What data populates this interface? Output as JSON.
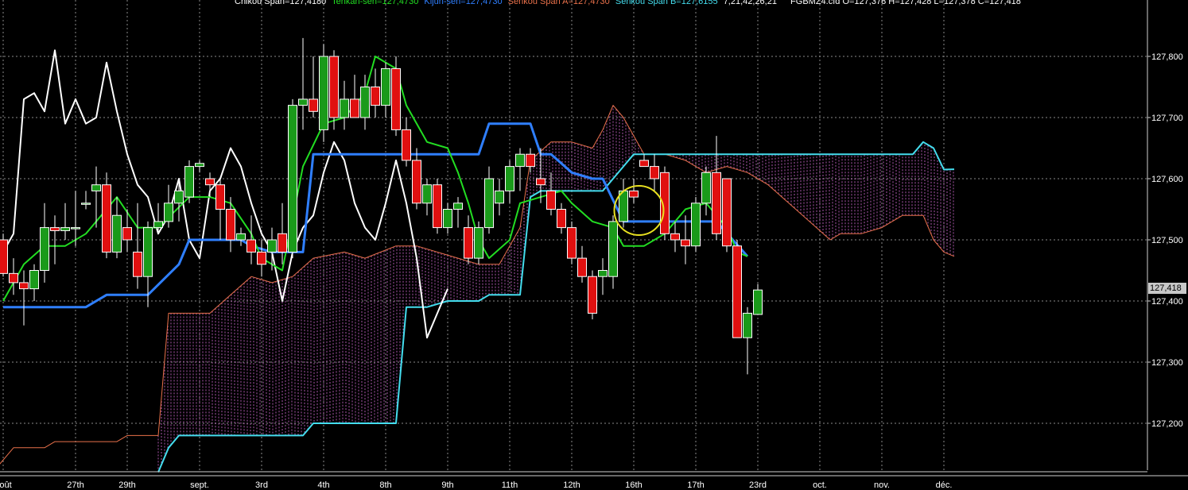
{
  "header": {
    "chikou": "Chikou Span=127,4180",
    "tenkan": "Tenkan-sen=127,4730",
    "kijun": "Kijun-sen=127,4730",
    "senkou_a": "Senkou Span A=127,4730",
    "senkou_b": "Senkou Span B=127,6155",
    "params": "7,21,42,26,21",
    "ohlc": "FGBMZ4.cfd O=127,378 H=127,428 L=127,378 C=127,418"
  },
  "colors": {
    "background": "#000000",
    "bull": "#1a9a1a",
    "bear": "#e01010",
    "tenkan": "#22dd22",
    "kijun": "#2f7fff",
    "senkou_a": "#e8704a",
    "senkou_b": "#44ddee",
    "chikou": "#ffffff",
    "cloud_hatch": "#cc66cc",
    "grid": "#8a8a8a",
    "highlight_circle": "#e8e020"
  },
  "last_price_label": "127,418",
  "chart_data": {
    "type": "candlestick",
    "symbol": "FGBMZ4.cfd",
    "ylim": [
      127.14,
      127.88
    ],
    "y_ticks": [
      {
        "value": 127.8,
        "label": "127,800"
      },
      {
        "value": 127.7,
        "label": "127,700"
      },
      {
        "value": 127.6,
        "label": "127,600"
      },
      {
        "value": 127.5,
        "label": "127,500"
      },
      {
        "value": 127.4,
        "label": "127,400"
      },
      {
        "value": 127.3,
        "label": "127,300"
      },
      {
        "value": 127.2,
        "label": "127,200"
      }
    ],
    "x_labels": [
      {
        "bar": 0,
        "label": "août"
      },
      {
        "bar": 7,
        "label": "27th"
      },
      {
        "bar": 12,
        "label": "29th"
      },
      {
        "bar": 19,
        "label": "sept."
      },
      {
        "bar": 25,
        "label": "3rd"
      },
      {
        "bar": 31,
        "label": "4th"
      },
      {
        "bar": 37,
        "label": "8th"
      },
      {
        "bar": 43,
        "label": "9th"
      },
      {
        "bar": 49,
        "label": "11th"
      },
      {
        "bar": 55,
        "label": "12th"
      },
      {
        "bar": 61,
        "label": "16th"
      },
      {
        "bar": 67,
        "label": "17th"
      },
      {
        "bar": 73,
        "label": "23rd"
      },
      {
        "bar": 79,
        "label": "oct."
      },
      {
        "bar": 85,
        "label": "nov."
      },
      {
        "bar": 91,
        "label": "déc."
      }
    ],
    "candles": [
      {
        "o": 127.5,
        "h": 127.51,
        "l": 127.44,
        "c": 127.445
      },
      {
        "o": 127.445,
        "h": 127.47,
        "l": 127.41,
        "c": 127.43
      },
      {
        "o": 127.43,
        "h": 127.45,
        "l": 127.36,
        "c": 127.42
      },
      {
        "o": 127.42,
        "h": 127.46,
        "l": 127.4,
        "c": 127.45
      },
      {
        "o": 127.45,
        "h": 127.56,
        "l": 127.43,
        "c": 127.52
      },
      {
        "o": 127.52,
        "h": 127.54,
        "l": 127.46,
        "c": 127.515
      },
      {
        "o": 127.515,
        "h": 127.56,
        "l": 127.5,
        "c": 127.52
      },
      {
        "o": 127.52,
        "h": 127.58,
        "l": 127.49,
        "c": 127.52
      },
      {
        "o": 127.56,
        "h": 127.58,
        "l": 127.55,
        "c": 127.56
      },
      {
        "o": 127.58,
        "h": 127.62,
        "l": 127.52,
        "c": 127.59
      },
      {
        "o": 127.59,
        "h": 127.61,
        "l": 127.47,
        "c": 127.48
      },
      {
        "o": 127.48,
        "h": 127.57,
        "l": 127.47,
        "c": 127.54
      },
      {
        "o": 127.52,
        "h": 127.55,
        "l": 127.48,
        "c": 127.5
      },
      {
        "o": 127.48,
        "h": 127.56,
        "l": 127.42,
        "c": 127.44
      },
      {
        "o": 127.44,
        "h": 127.53,
        "l": 127.39,
        "c": 127.52
      },
      {
        "o": 127.52,
        "h": 127.56,
        "l": 127.51,
        "c": 127.53
      },
      {
        "o": 127.53,
        "h": 127.59,
        "l": 127.52,
        "c": 127.56
      },
      {
        "o": 127.56,
        "h": 127.6,
        "l": 127.53,
        "c": 127.58
      },
      {
        "o": 127.57,
        "h": 127.63,
        "l": 127.56,
        "c": 127.62
      },
      {
        "o": 127.62,
        "h": 127.63,
        "l": 127.61,
        "c": 127.625
      },
      {
        "o": 127.6,
        "h": 127.61,
        "l": 127.57,
        "c": 127.59
      },
      {
        "o": 127.59,
        "h": 127.6,
        "l": 127.5,
        "c": 127.55
      },
      {
        "o": 127.55,
        "h": 127.57,
        "l": 127.48,
        "c": 127.5
      },
      {
        "o": 127.5,
        "h": 127.52,
        "l": 127.49,
        "c": 127.51
      },
      {
        "o": 127.5,
        "h": 127.54,
        "l": 127.46,
        "c": 127.48
      },
      {
        "o": 127.48,
        "h": 127.5,
        "l": 127.44,
        "c": 127.46
      },
      {
        "o": 127.48,
        "h": 127.52,
        "l": 127.45,
        "c": 127.5
      },
      {
        "o": 127.51,
        "h": 127.56,
        "l": 127.46,
        "c": 127.48
      },
      {
        "o": 127.48,
        "h": 127.73,
        "l": 127.47,
        "c": 127.72
      },
      {
        "o": 127.72,
        "h": 127.83,
        "l": 127.68,
        "c": 127.73
      },
      {
        "o": 127.73,
        "h": 127.8,
        "l": 127.7,
        "c": 127.71
      },
      {
        "o": 127.68,
        "h": 127.82,
        "l": 127.66,
        "c": 127.8
      },
      {
        "o": 127.8,
        "h": 127.81,
        "l": 127.68,
        "c": 127.7
      },
      {
        "o": 127.7,
        "h": 127.76,
        "l": 127.68,
        "c": 127.73
      },
      {
        "o": 127.73,
        "h": 127.77,
        "l": 127.7,
        "c": 127.7
      },
      {
        "o": 127.7,
        "h": 127.77,
        "l": 127.68,
        "c": 127.75
      },
      {
        "o": 127.75,
        "h": 127.78,
        "l": 127.7,
        "c": 127.72
      },
      {
        "o": 127.72,
        "h": 127.79,
        "l": 127.7,
        "c": 127.78
      },
      {
        "o": 127.78,
        "h": 127.8,
        "l": 127.67,
        "c": 127.68
      },
      {
        "o": 127.68,
        "h": 127.7,
        "l": 127.62,
        "c": 127.63
      },
      {
        "o": 127.63,
        "h": 127.65,
        "l": 127.55,
        "c": 127.56
      },
      {
        "o": 127.56,
        "h": 127.6,
        "l": 127.54,
        "c": 127.59
      },
      {
        "o": 127.59,
        "h": 127.6,
        "l": 127.51,
        "c": 127.52
      },
      {
        "o": 127.52,
        "h": 127.56,
        "l": 127.51,
        "c": 127.55
      },
      {
        "o": 127.55,
        "h": 127.57,
        "l": 127.52,
        "c": 127.56
      },
      {
        "o": 127.52,
        "h": 127.54,
        "l": 127.46,
        "c": 127.47
      },
      {
        "o": 127.47,
        "h": 127.53,
        "l": 127.46,
        "c": 127.52
      },
      {
        "o": 127.52,
        "h": 127.62,
        "l": 127.51,
        "c": 127.6
      },
      {
        "o": 127.56,
        "h": 127.6,
        "l": 127.54,
        "c": 127.58
      },
      {
        "o": 127.58,
        "h": 127.63,
        "l": 127.56,
        "c": 127.62
      },
      {
        "o": 127.62,
        "h": 127.65,
        "l": 127.58,
        "c": 127.64
      },
      {
        "o": 127.64,
        "h": 127.65,
        "l": 127.61,
        "c": 127.62
      },
      {
        "o": 127.6,
        "h": 127.65,
        "l": 127.56,
        "c": 127.59
      },
      {
        "o": 127.58,
        "h": 127.61,
        "l": 127.54,
        "c": 127.55
      },
      {
        "o": 127.55,
        "h": 127.56,
        "l": 127.51,
        "c": 127.52
      },
      {
        "o": 127.52,
        "h": 127.53,
        "l": 127.46,
        "c": 127.47
      },
      {
        "o": 127.47,
        "h": 127.49,
        "l": 127.43,
        "c": 127.44
      },
      {
        "o": 127.44,
        "h": 127.45,
        "l": 127.37,
        "c": 127.38
      },
      {
        "o": 127.44,
        "h": 127.47,
        "l": 127.41,
        "c": 127.45
      },
      {
        "o": 127.44,
        "h": 127.54,
        "l": 127.42,
        "c": 127.53
      },
      {
        "o": 127.53,
        "h": 127.6,
        "l": 127.52,
        "c": 127.58
      },
      {
        "o": 127.58,
        "h": 127.6,
        "l": 127.56,
        "c": 127.57
      },
      {
        "o": 127.63,
        "h": 127.64,
        "l": 127.62,
        "c": 127.62
      },
      {
        "o": 127.62,
        "h": 127.64,
        "l": 127.58,
        "c": 127.6
      },
      {
        "o": 127.61,
        "h": 127.62,
        "l": 127.5,
        "c": 127.51
      },
      {
        "o": 127.51,
        "h": 127.53,
        "l": 127.48,
        "c": 127.5
      },
      {
        "o": 127.5,
        "h": 127.54,
        "l": 127.46,
        "c": 127.49
      },
      {
        "o": 127.49,
        "h": 127.57,
        "l": 127.48,
        "c": 127.56
      },
      {
        "o": 127.56,
        "h": 127.62,
        "l": 127.54,
        "c": 127.61
      },
      {
        "o": 127.61,
        "h": 127.67,
        "l": 127.5,
        "c": 127.51
      },
      {
        "o": 127.6,
        "h": 127.6,
        "l": 127.48,
        "c": 127.49
      },
      {
        "o": 127.49,
        "h": 127.5,
        "l": 127.34,
        "c": 127.34
      },
      {
        "o": 127.34,
        "h": 127.39,
        "l": 127.28,
        "c": 127.38
      },
      {
        "o": 127.378,
        "h": 127.428,
        "l": 127.378,
        "c": 127.418
      }
    ],
    "tenkan": [
      {
        "bar": 0,
        "v": 127.4
      },
      {
        "bar": 2,
        "v": 127.46
      },
      {
        "bar": 4,
        "v": 127.49
      },
      {
        "bar": 6,
        "v": 127.49
      },
      {
        "bar": 8,
        "v": 127.51
      },
      {
        "bar": 10,
        "v": 127.55
      },
      {
        "bar": 11,
        "v": 127.57
      },
      {
        "bar": 13,
        "v": 127.52
      },
      {
        "bar": 15,
        "v": 127.52
      },
      {
        "bar": 18,
        "v": 127.57
      },
      {
        "bar": 20,
        "v": 127.57
      },
      {
        "bar": 22,
        "v": 127.56
      },
      {
        "bar": 24,
        "v": 127.51
      },
      {
        "bar": 25,
        "v": 127.47
      },
      {
        "bar": 27,
        "v": 127.45
      },
      {
        "bar": 29,
        "v": 127.62
      },
      {
        "bar": 31,
        "v": 127.69
      },
      {
        "bar": 33,
        "v": 127.7
      },
      {
        "bar": 35,
        "v": 127.74
      },
      {
        "bar": 36,
        "v": 127.8
      },
      {
        "bar": 38,
        "v": 127.78
      },
      {
        "bar": 39,
        "v": 127.72
      },
      {
        "bar": 41,
        "v": 127.66
      },
      {
        "bar": 43,
        "v": 127.65
      },
      {
        "bar": 44,
        "v": 127.61
      },
      {
        "bar": 45,
        "v": 127.56
      },
      {
        "bar": 46,
        "v": 127.5
      },
      {
        "bar": 47,
        "v": 127.47
      },
      {
        "bar": 49,
        "v": 127.5
      },
      {
        "bar": 50,
        "v": 127.56
      },
      {
        "bar": 52,
        "v": 127.57
      },
      {
        "bar": 54,
        "v": 127.58
      },
      {
        "bar": 55,
        "v": 127.56
      },
      {
        "bar": 57,
        "v": 127.53
      },
      {
        "bar": 59,
        "v": 127.52
      },
      {
        "bar": 60,
        "v": 127.49
      },
      {
        "bar": 62,
        "v": 127.49
      },
      {
        "bar": 64,
        "v": 127.51
      },
      {
        "bar": 66,
        "v": 127.55
      },
      {
        "bar": 68,
        "v": 127.56
      },
      {
        "bar": 70,
        "v": 127.52
      },
      {
        "bar": 71,
        "v": 127.48
      },
      {
        "bar": 72,
        "v": 127.473
      }
    ],
    "kijun": [
      {
        "bar": 0,
        "v": 127.39
      },
      {
        "bar": 8,
        "v": 127.39
      },
      {
        "bar": 10,
        "v": 127.41
      },
      {
        "bar": 14,
        "v": 127.41
      },
      {
        "bar": 17,
        "v": 127.46
      },
      {
        "bar": 18,
        "v": 127.5
      },
      {
        "bar": 23,
        "v": 127.5
      },
      {
        "bar": 24,
        "v": 127.49
      },
      {
        "bar": 26,
        "v": 127.48
      },
      {
        "bar": 29,
        "v": 127.48
      },
      {
        "bar": 30,
        "v": 127.64
      },
      {
        "bar": 46,
        "v": 127.64
      },
      {
        "bar": 47,
        "v": 127.69
      },
      {
        "bar": 51,
        "v": 127.69
      },
      {
        "bar": 52,
        "v": 127.64
      },
      {
        "bar": 53,
        "v": 127.64
      },
      {
        "bar": 55,
        "v": 127.61
      },
      {
        "bar": 57,
        "v": 127.6
      },
      {
        "bar": 58,
        "v": 127.6
      },
      {
        "bar": 60,
        "v": 127.53
      },
      {
        "bar": 69,
        "v": 127.53
      },
      {
        "bar": 72,
        "v": 127.473
      }
    ],
    "senkou_a": [
      {
        "bar": -1,
        "v": 127.12
      },
      {
        "bar": 1,
        "v": 127.16
      },
      {
        "bar": 4,
        "v": 127.16
      },
      {
        "bar": 5,
        "v": 127.17
      },
      {
        "bar": 11,
        "v": 127.17
      },
      {
        "bar": 12,
        "v": 127.18
      },
      {
        "bar": 15,
        "v": 127.18
      },
      {
        "bar": 16,
        "v": 127.38
      },
      {
        "bar": 20,
        "v": 127.38
      },
      {
        "bar": 22,
        "v": 127.41
      },
      {
        "bar": 24,
        "v": 127.44
      },
      {
        "bar": 26,
        "v": 127.43
      },
      {
        "bar": 28,
        "v": 127.44
      },
      {
        "bar": 30,
        "v": 127.47
      },
      {
        "bar": 33,
        "v": 127.48
      },
      {
        "bar": 35,
        "v": 127.47
      },
      {
        "bar": 38,
        "v": 127.49
      },
      {
        "bar": 40,
        "v": 127.49
      },
      {
        "bar": 44,
        "v": 127.47
      },
      {
        "bar": 46,
        "v": 127.46
      },
      {
        "bar": 48,
        "v": 127.46
      },
      {
        "bar": 50,
        "v": 127.52
      },
      {
        "bar": 51,
        "v": 127.63
      },
      {
        "bar": 53,
        "v": 127.66
      },
      {
        "bar": 55,
        "v": 127.66
      },
      {
        "bar": 57,
        "v": 127.65
      },
      {
        "bar": 58,
        "v": 127.68
      },
      {
        "bar": 59,
        "v": 127.72
      },
      {
        "bar": 60,
        "v": 127.7
      },
      {
        "bar": 62,
        "v": 127.64
      },
      {
        "bar": 64,
        "v": 127.64
      },
      {
        "bar": 66,
        "v": 127.63
      },
      {
        "bar": 68,
        "v": 127.61
      },
      {
        "bar": 70,
        "v": 127.62
      },
      {
        "bar": 72,
        "v": 127.61
      },
      {
        "bar": 74,
        "v": 127.59
      },
      {
        "bar": 76,
        "v": 127.56
      },
      {
        "bar": 78,
        "v": 127.53
      },
      {
        "bar": 80,
        "v": 127.5
      },
      {
        "bar": 81,
        "v": 127.51
      },
      {
        "bar": 83,
        "v": 127.51
      },
      {
        "bar": 85,
        "v": 127.52
      },
      {
        "bar": 87,
        "v": 127.54
      },
      {
        "bar": 89,
        "v": 127.54
      },
      {
        "bar": 90,
        "v": 127.5
      },
      {
        "bar": 91,
        "v": 127.48
      },
      {
        "bar": 92,
        "v": 127.473
      }
    ],
    "senkou_b": [
      {
        "bar": 15,
        "v": 127.12
      },
      {
        "bar": 16,
        "v": 127.16
      },
      {
        "bar": 17,
        "v": 127.18
      },
      {
        "bar": 29,
        "v": 127.18
      },
      {
        "bar": 30,
        "v": 127.2
      },
      {
        "bar": 38,
        "v": 127.2
      },
      {
        "bar": 39,
        "v": 127.39
      },
      {
        "bar": 41,
        "v": 127.39
      },
      {
        "bar": 43,
        "v": 127.4
      },
      {
        "bar": 46,
        "v": 127.4
      },
      {
        "bar": 47,
        "v": 127.41
      },
      {
        "bar": 50,
        "v": 127.41
      },
      {
        "bar": 51,
        "v": 127.57
      },
      {
        "bar": 52,
        "v": 127.58
      },
      {
        "bar": 58,
        "v": 127.58
      },
      {
        "bar": 60,
        "v": 127.62
      },
      {
        "bar": 61,
        "v": 127.64
      },
      {
        "bar": 88,
        "v": 127.64
      },
      {
        "bar": 89,
        "v": 127.66
      },
      {
        "bar": 90,
        "v": 127.65
      },
      {
        "bar": 91,
        "v": 127.615
      },
      {
        "bar": 92,
        "v": 127.6155
      }
    ],
    "chikou": [
      {
        "bar": 0,
        "v": 127.48
      },
      {
        "bar": 1,
        "v": 127.51
      },
      {
        "bar": 2,
        "v": 127.73
      },
      {
        "bar": 3,
        "v": 127.74
      },
      {
        "bar": 4,
        "v": 127.71
      },
      {
        "bar": 5,
        "v": 127.81
      },
      {
        "bar": 6,
        "v": 127.69
      },
      {
        "bar": 7,
        "v": 127.73
      },
      {
        "bar": 8,
        "v": 127.69
      },
      {
        "bar": 9,
        "v": 127.7
      },
      {
        "bar": 10,
        "v": 127.79
      },
      {
        "bar": 11,
        "v": 127.71
      },
      {
        "bar": 12,
        "v": 127.64
      },
      {
        "bar": 13,
        "v": 127.59
      },
      {
        "bar": 14,
        "v": 127.57
      },
      {
        "bar": 15,
        "v": 127.51
      },
      {
        "bar": 16,
        "v": 127.54
      },
      {
        "bar": 17,
        "v": 127.6
      },
      {
        "bar": 18,
        "v": 127.5
      },
      {
        "bar": 19,
        "v": 127.47
      },
      {
        "bar": 20,
        "v": 127.58
      },
      {
        "bar": 21,
        "v": 127.6
      },
      {
        "bar": 22,
        "v": 127.65
      },
      {
        "bar": 23,
        "v": 127.62
      },
      {
        "bar": 24,
        "v": 127.56
      },
      {
        "bar": 25,
        "v": 127.51
      },
      {
        "bar": 26,
        "v": 127.48
      },
      {
        "bar": 27,
        "v": 127.4
      },
      {
        "bar": 28,
        "v": 127.48
      },
      {
        "bar": 29,
        "v": 127.52
      },
      {
        "bar": 30,
        "v": 127.54
      },
      {
        "bar": 31,
        "v": 127.61
      },
      {
        "bar": 32,
        "v": 127.66
      },
      {
        "bar": 33,
        "v": 127.63
      },
      {
        "bar": 34,
        "v": 127.56
      },
      {
        "bar": 35,
        "v": 127.52
      },
      {
        "bar": 36,
        "v": 127.5
      },
      {
        "bar": 37,
        "v": 127.56
      },
      {
        "bar": 38,
        "v": 127.63
      },
      {
        "bar": 39,
        "v": 127.56
      },
      {
        "bar": 40,
        "v": 127.47
      },
      {
        "bar": 41,
        "v": 127.34
      },
      {
        "bar": 42,
        "v": 127.38
      },
      {
        "bar": 43,
        "v": 127.42
      }
    ],
    "cloud_end_bar": 92,
    "highlight": {
      "bar": 61.5,
      "v": 127.548
    }
  }
}
